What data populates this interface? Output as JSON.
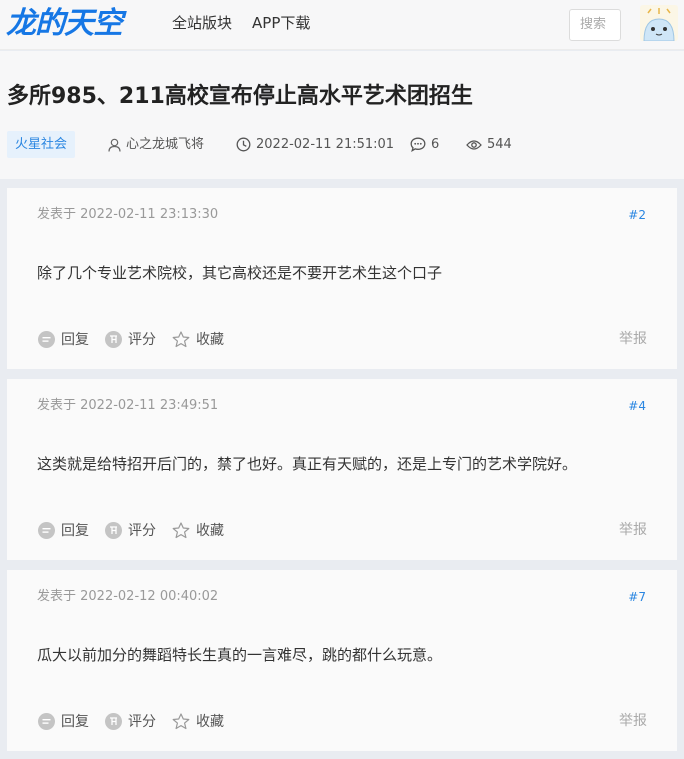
{
  "header": {
    "logo_text": "龙的天空",
    "nav": [
      "全站版块",
      "APP下载"
    ],
    "search_placeholder": "搜索"
  },
  "thread": {
    "title": "多所985、211高校宣布停止高水平艺术团招生",
    "tag": "火星社会",
    "author": "心之龙城飞将",
    "time": "2022-02-11 21:51:01",
    "comments": "6",
    "views": "544"
  },
  "posts": [
    {
      "time": "发表于 2022-02-11 23:13:30",
      "floor": "#2",
      "body": "除了几个专业艺术院校，其它高校还是不要开艺术生这个口子"
    },
    {
      "time": "发表于 2022-02-11 23:49:51",
      "floor": "#4",
      "body": "这类就是给特招开后门的，禁了也好。真正有天赋的，还是上专门的艺术学院好。"
    },
    {
      "time": "发表于 2022-02-12 00:40:02",
      "floor": "#7",
      "body": "瓜大以前加分的舞蹈特长生真的一言难尽，跳的都什么玩意。"
    }
  ],
  "actions": {
    "reply": "回复",
    "rate": "评分",
    "favorite": "收藏",
    "report": "举报"
  },
  "colors": {
    "accent": "#1677e5",
    "tag_bg": "#e6f1fc",
    "page_bg": "#e9ecf1"
  }
}
